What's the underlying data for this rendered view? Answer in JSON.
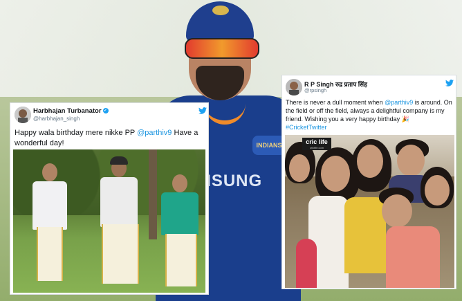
{
  "background": {
    "player": {
      "sponsor_text": "MSUNG",
      "badge_text": "INDIANS"
    }
  },
  "tweet_left": {
    "name": "Harbhajan Turbanator",
    "handle": "@harbhajan_singh",
    "text_before": "Happy wala birthday mere nikke PP ",
    "mention": "@parthiv9",
    "text_after": " Have a wonderful day!",
    "icons": {
      "avatar": "avatar",
      "verified": "verified-badge-icon",
      "platform": "twitter-bird-icon"
    },
    "colors": {
      "link": "#1b95e0",
      "bird": "#1da1f2"
    }
  },
  "tweet_right": {
    "name": "R P Singh रुद्र प्रताप सिंह",
    "handle": "@rpsingh",
    "text_part1": "There is never a dull moment when ",
    "mention": "@parthiv9",
    "text_part2": " is around. On the field or off the field, always a delightful company is my friend. Wishing you a very happy birthday ",
    "emoji": "🎉",
    "hashtag": "#CricketTwitter",
    "watermark": {
      "brand": "cric life",
      "sub": "crictife.com"
    },
    "icons": {
      "avatar": "avatar",
      "verified": "verified-badge-icon",
      "platform": "twitter-bird-icon"
    }
  }
}
